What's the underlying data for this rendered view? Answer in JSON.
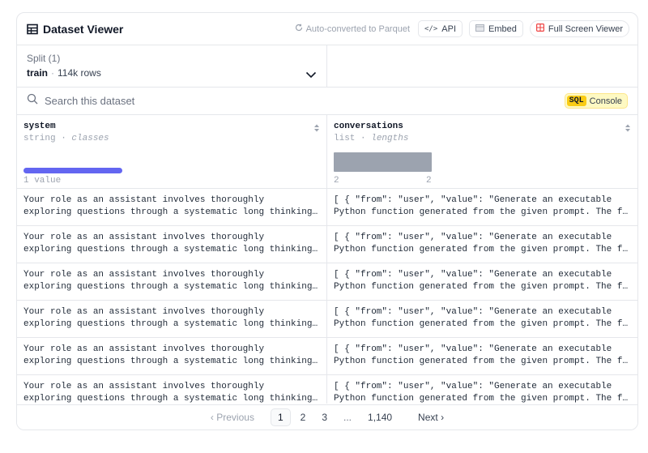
{
  "header": {
    "title": "Dataset Viewer",
    "auto_converted": "Auto-converted to Parquet",
    "api_label": "API",
    "embed_label": "Embed",
    "fullscreen_label": "Full Screen Viewer"
  },
  "split": {
    "label": "Split (1)",
    "name": "train",
    "separator": "·",
    "rows": "114k rows"
  },
  "search": {
    "placeholder": "Search this dataset",
    "sql_tag": "SQL",
    "console_label": "Console"
  },
  "columns": [
    {
      "name": "system",
      "type": "string",
      "stat": "classes",
      "footer": "1 value"
    },
    {
      "name": "conversations",
      "type": "list",
      "stat": "lengths",
      "footer_min": "2",
      "footer_max": "2"
    }
  ],
  "rows": [
    {
      "system_l1": "Your role as an assistant involves thoroughly",
      "system_l2": "exploring questions through a systematic long thinking process before providing the final",
      "conv_l1": "[ { \"from\": \"user\", \"value\": \"Generate an executable",
      "conv_l2": "Python function generated from the given prompt. The function should take stdin"
    },
    {
      "system_l1": "Your role as an assistant involves thoroughly",
      "system_l2": "exploring questions through a systematic long thinking process before providing the final",
      "conv_l1": "[ { \"from\": \"user\", \"value\": \"Generate an executable",
      "conv_l2": "Python function generated from the given prompt. The function should take stdin"
    },
    {
      "system_l1": "Your role as an assistant involves thoroughly",
      "system_l2": "exploring questions through a systematic long thinking process before providing the final",
      "conv_l1": "[ { \"from\": \"user\", \"value\": \"Generate an executable",
      "conv_l2": "Python function generated from the given prompt. The function should take stdin"
    },
    {
      "system_l1": "Your role as an assistant involves thoroughly",
      "system_l2": "exploring questions through a systematic long thinking process before providing the final",
      "conv_l1": "[ { \"from\": \"user\", \"value\": \"Generate an executable",
      "conv_l2": "Python function generated from the given prompt. The function should take stdin"
    },
    {
      "system_l1": "Your role as an assistant involves thoroughly",
      "system_l2": "exploring questions through a systematic long thinking process before providing the final",
      "conv_l1": "[ { \"from\": \"user\", \"value\": \"Generate an executable",
      "conv_l2": "Python function generated from the given prompt. The function should take stdin"
    },
    {
      "system_l1": "Your role as an assistant involves thoroughly",
      "system_l2": "exploring questions through a systematic long thinking process before providing the final",
      "conv_l1": "[ { \"from\": \"user\", \"value\": \"Generate an executable",
      "conv_l2": "Python function generated from the given prompt. The function should take stdin"
    }
  ],
  "pagination": {
    "previous": "Previous",
    "next": "Next",
    "pages": [
      "1",
      "2",
      "3"
    ],
    "ellipsis": "...",
    "last": "1,140",
    "current": "1"
  },
  "colors": {
    "accent": "#6366f1",
    "sql_yellow": "#facc15",
    "fullscreen_icon": "#ef4444"
  },
  "icons": {
    "title": "table-icon",
    "auto_converted": "refresh-icon",
    "api": "code-icon",
    "embed": "embed-icon",
    "fullscreen": "fullscreen-icon",
    "split": "chevron-down-icon",
    "search": "search-icon",
    "sort": "sort-icon"
  }
}
